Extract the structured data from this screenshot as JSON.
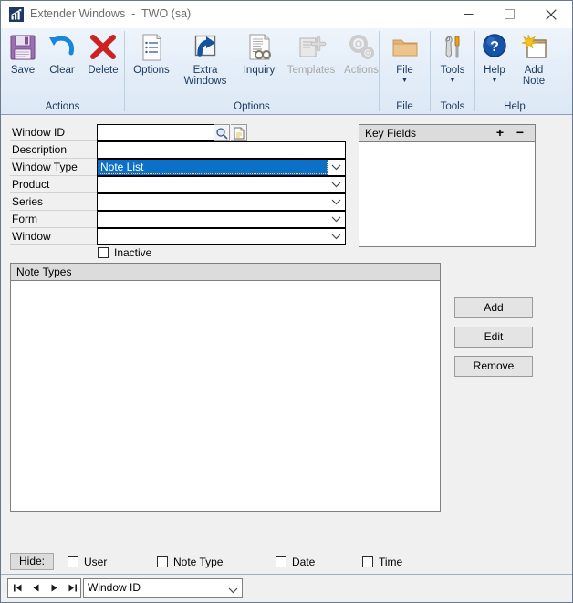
{
  "window": {
    "title": "Extender Windows  -  TWO (sa)",
    "app_icon": "bar-chart-icon",
    "controls": {
      "minimize": "minimize-icon",
      "maximize": "maximize-icon",
      "close": "close-icon"
    }
  },
  "ribbon": {
    "groups": [
      {
        "name": "Actions",
        "label": "Actions",
        "items": [
          {
            "label": "Save",
            "icon": "floppy-disk-icon",
            "disabled": false,
            "dropdown": false
          },
          {
            "label": "Clear",
            "icon": "undo-arrow-icon",
            "disabled": false,
            "dropdown": false
          },
          {
            "label": "Delete",
            "icon": "red-x-icon",
            "disabled": false,
            "dropdown": false
          }
        ]
      },
      {
        "name": "Options",
        "label": "Options",
        "items": [
          {
            "label": "Options",
            "icon": "document-list-icon",
            "disabled": false,
            "dropdown": false
          },
          {
            "label": "Extra\nWindows",
            "icon": "extra-windows-icon",
            "disabled": false,
            "dropdown": false
          },
          {
            "label": "Inquiry",
            "icon": "inquiry-document-icon",
            "disabled": false,
            "dropdown": false
          },
          {
            "label": "Templates",
            "icon": "templates-icon",
            "disabled": true,
            "dropdown": false
          },
          {
            "label": "Actions",
            "icon": "gears-icon",
            "disabled": true,
            "dropdown": false
          }
        ]
      },
      {
        "name": "File",
        "label": "File",
        "items": [
          {
            "label": "File",
            "icon": "folder-icon",
            "disabled": false,
            "dropdown": true
          }
        ]
      },
      {
        "name": "Tools",
        "label": "Tools",
        "items": [
          {
            "label": "Tools",
            "icon": "wrench-screwdriver-icon",
            "disabled": false,
            "dropdown": true
          }
        ]
      },
      {
        "name": "Help",
        "label": "Help",
        "items": [
          {
            "label": "Help",
            "icon": "help-question-icon",
            "disabled": false,
            "dropdown": true
          },
          {
            "label": "Add\nNote",
            "icon": "add-note-icon",
            "disabled": false,
            "dropdown": false
          }
        ]
      }
    ]
  },
  "form": {
    "fields": [
      {
        "label": "Window ID",
        "type": "text",
        "value": "",
        "placeholder": ""
      },
      {
        "label": "Description",
        "type": "text",
        "value": "",
        "placeholder": ""
      },
      {
        "label": "Window Type",
        "type": "combo",
        "value": "Note List",
        "selected": true
      },
      {
        "label": "Product",
        "type": "combo",
        "value": "",
        "selected": false
      },
      {
        "label": "Series",
        "type": "combo",
        "value": "",
        "selected": false
      },
      {
        "label": "Form",
        "type": "combo",
        "value": "",
        "selected": false
      },
      {
        "label": "Window",
        "type": "combo",
        "value": "",
        "selected": false
      }
    ],
    "lookup_icon": "magnifier-icon",
    "new_icon": "new-document-icon",
    "inactive": {
      "label": "Inactive",
      "checked": false
    }
  },
  "key_fields": {
    "title": "Key Fields",
    "add_label": "+",
    "remove_label": "−",
    "rows": []
  },
  "note_types": {
    "title": "Note Types",
    "rows": [],
    "buttons": [
      {
        "label": "Add"
      },
      {
        "label": "Edit"
      },
      {
        "label": "Remove"
      }
    ]
  },
  "hide_bar": {
    "label": "Hide:",
    "checkboxes": [
      {
        "label": "User",
        "checked": false
      },
      {
        "label": "Note Type",
        "checked": false
      },
      {
        "label": "Date",
        "checked": false
      },
      {
        "label": "Time",
        "checked": false
      }
    ]
  },
  "status_bar": {
    "nav": [
      {
        "name": "first",
        "glyph": "first-record-icon"
      },
      {
        "name": "prev",
        "glyph": "previous-record-icon"
      },
      {
        "name": "next",
        "glyph": "next-record-icon"
      },
      {
        "name": "last",
        "glyph": "last-record-icon"
      }
    ],
    "sort_value": "Window ID"
  },
  "colors": {
    "selection_blue": "#0a70c8",
    "ribbon_text": "#1b3a5c",
    "window_bg": "#f0f0f0",
    "panel_header": "#dcdcdc"
  }
}
